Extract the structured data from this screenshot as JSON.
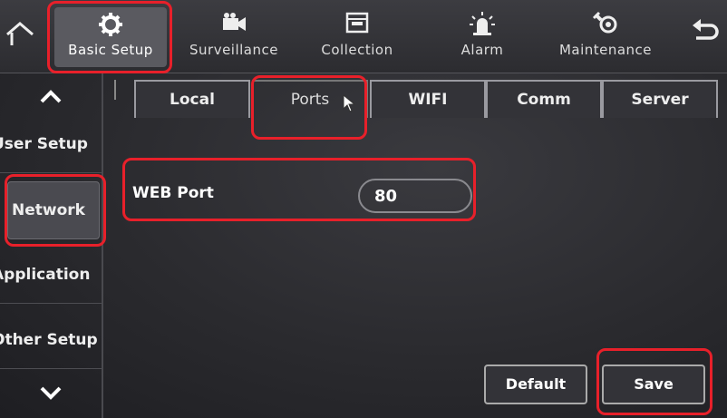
{
  "topnav": {
    "items": [
      {
        "label": "Basic Setup",
        "icon": "gear-icon"
      },
      {
        "label": "Surveillance",
        "icon": "camera-icon"
      },
      {
        "label": "Collection",
        "icon": "folder-icon"
      },
      {
        "label": "Alarm",
        "icon": "siren-icon"
      },
      {
        "label": "Maintenance",
        "icon": "wrench-icon"
      }
    ],
    "home_icon": "home-icon",
    "back_icon": "back-icon"
  },
  "sidebar": {
    "items": [
      {
        "label": "User Setup"
      },
      {
        "label": "Network"
      },
      {
        "label": "Application"
      },
      {
        "label": "Other Setup"
      }
    ]
  },
  "tabs": [
    {
      "label": "Local"
    },
    {
      "label": "Ports"
    },
    {
      "label": "WIFI"
    },
    {
      "label": "Comm"
    },
    {
      "label": "Server"
    }
  ],
  "form": {
    "web_port_label": "WEB Port",
    "web_port_value": "80"
  },
  "buttons": {
    "default_label": "Default",
    "save_label": "Save"
  },
  "colors": {
    "highlight": "#e8202a",
    "background": "#2b2b2f"
  }
}
